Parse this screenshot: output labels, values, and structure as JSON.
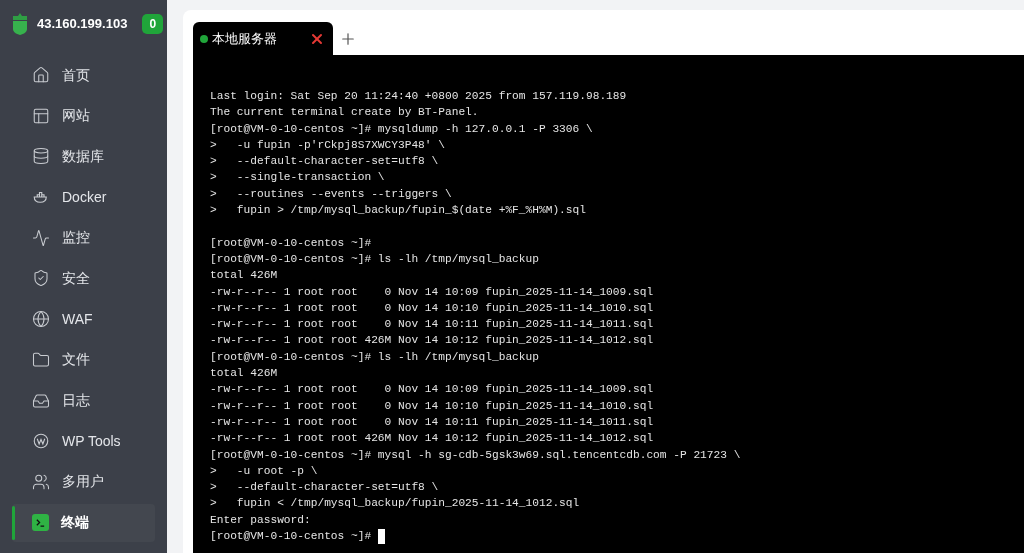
{
  "sidebar": {
    "server_ip": "43.160.199.103",
    "badge": "0",
    "items": [
      {
        "kind": "home",
        "label": "首页",
        "selected": false
      },
      {
        "kind": "site",
        "label": "网站",
        "selected": false
      },
      {
        "kind": "database",
        "label": "数据库",
        "selected": false
      },
      {
        "kind": "docker",
        "label": "Docker",
        "selected": false
      },
      {
        "kind": "monitor",
        "label": "监控",
        "selected": false
      },
      {
        "kind": "security",
        "label": "安全",
        "selected": false
      },
      {
        "kind": "waf",
        "label": "WAF",
        "selected": false
      },
      {
        "kind": "files",
        "label": "文件",
        "selected": false
      },
      {
        "kind": "logs",
        "label": "日志",
        "selected": false
      },
      {
        "kind": "wp",
        "label": "WP Tools",
        "selected": false
      },
      {
        "kind": "users",
        "label": "多用户",
        "selected": false
      },
      {
        "kind": "terminal",
        "label": "终端",
        "selected": true
      }
    ]
  },
  "tabs": [
    {
      "label": "本地服务器",
      "selected": true,
      "connected": true
    }
  ],
  "terminal": {
    "cursor": true,
    "blocks": [
      [
        "Last login: Sat Sep 20 11:24:40 +0800 2025 from 157.119.98.189",
        "The current terminal create by BT-Panel.",
        "[root@VM-0-10-centos ~]# mysqldump -h 127.0.0.1 -P 3306 \\",
        ">   -u fupin -p'rCkpj8S7XWCY3P48' \\",
        ">   --default-character-set=utf8 \\",
        ">   --single-transaction \\",
        ">   --routines --events --triggers \\",
        ">   fupin > /tmp/mysql_backup/fupin_$(date +%F_%H%M).sql"
      ],
      [
        "[root@VM-0-10-centos ~]#",
        "[root@VM-0-10-centos ~]# ls -lh /tmp/mysql_backup",
        "total 426M",
        "-rw-r--r-- 1 root root    0 Nov 14 10:09 fupin_2025-11-14_1009.sql",
        "-rw-r--r-- 1 root root    0 Nov 14 10:10 fupin_2025-11-14_1010.sql",
        "-rw-r--r-- 1 root root    0 Nov 14 10:11 fupin_2025-11-14_1011.sql",
        "-rw-r--r-- 1 root root 426M Nov 14 10:12 fupin_2025-11-14_1012.sql",
        "[root@VM-0-10-centos ~]# ls -lh /tmp/mysql_backup",
        "total 426M",
        "-rw-r--r-- 1 root root    0 Nov 14 10:09 fupin_2025-11-14_1009.sql",
        "-rw-r--r-- 1 root root    0 Nov 14 10:10 fupin_2025-11-14_1010.sql",
        "-rw-r--r-- 1 root root    0 Nov 14 10:11 fupin_2025-11-14_1011.sql",
        "-rw-r--r-- 1 root root 426M Nov 14 10:12 fupin_2025-11-14_1012.sql",
        "[root@VM-0-10-centos ~]# mysql -h sg-cdb-5gsk3w69.sql.tencentcdb.com -P 21723 \\",
        ">   -u root -p \\",
        ">   --default-character-set=utf8 \\",
        ">   fupin < /tmp/mysql_backup/fupin_2025-11-14_1012.sql",
        "Enter password:",
        "[root@VM-0-10-centos ~]# "
      ]
    ]
  }
}
